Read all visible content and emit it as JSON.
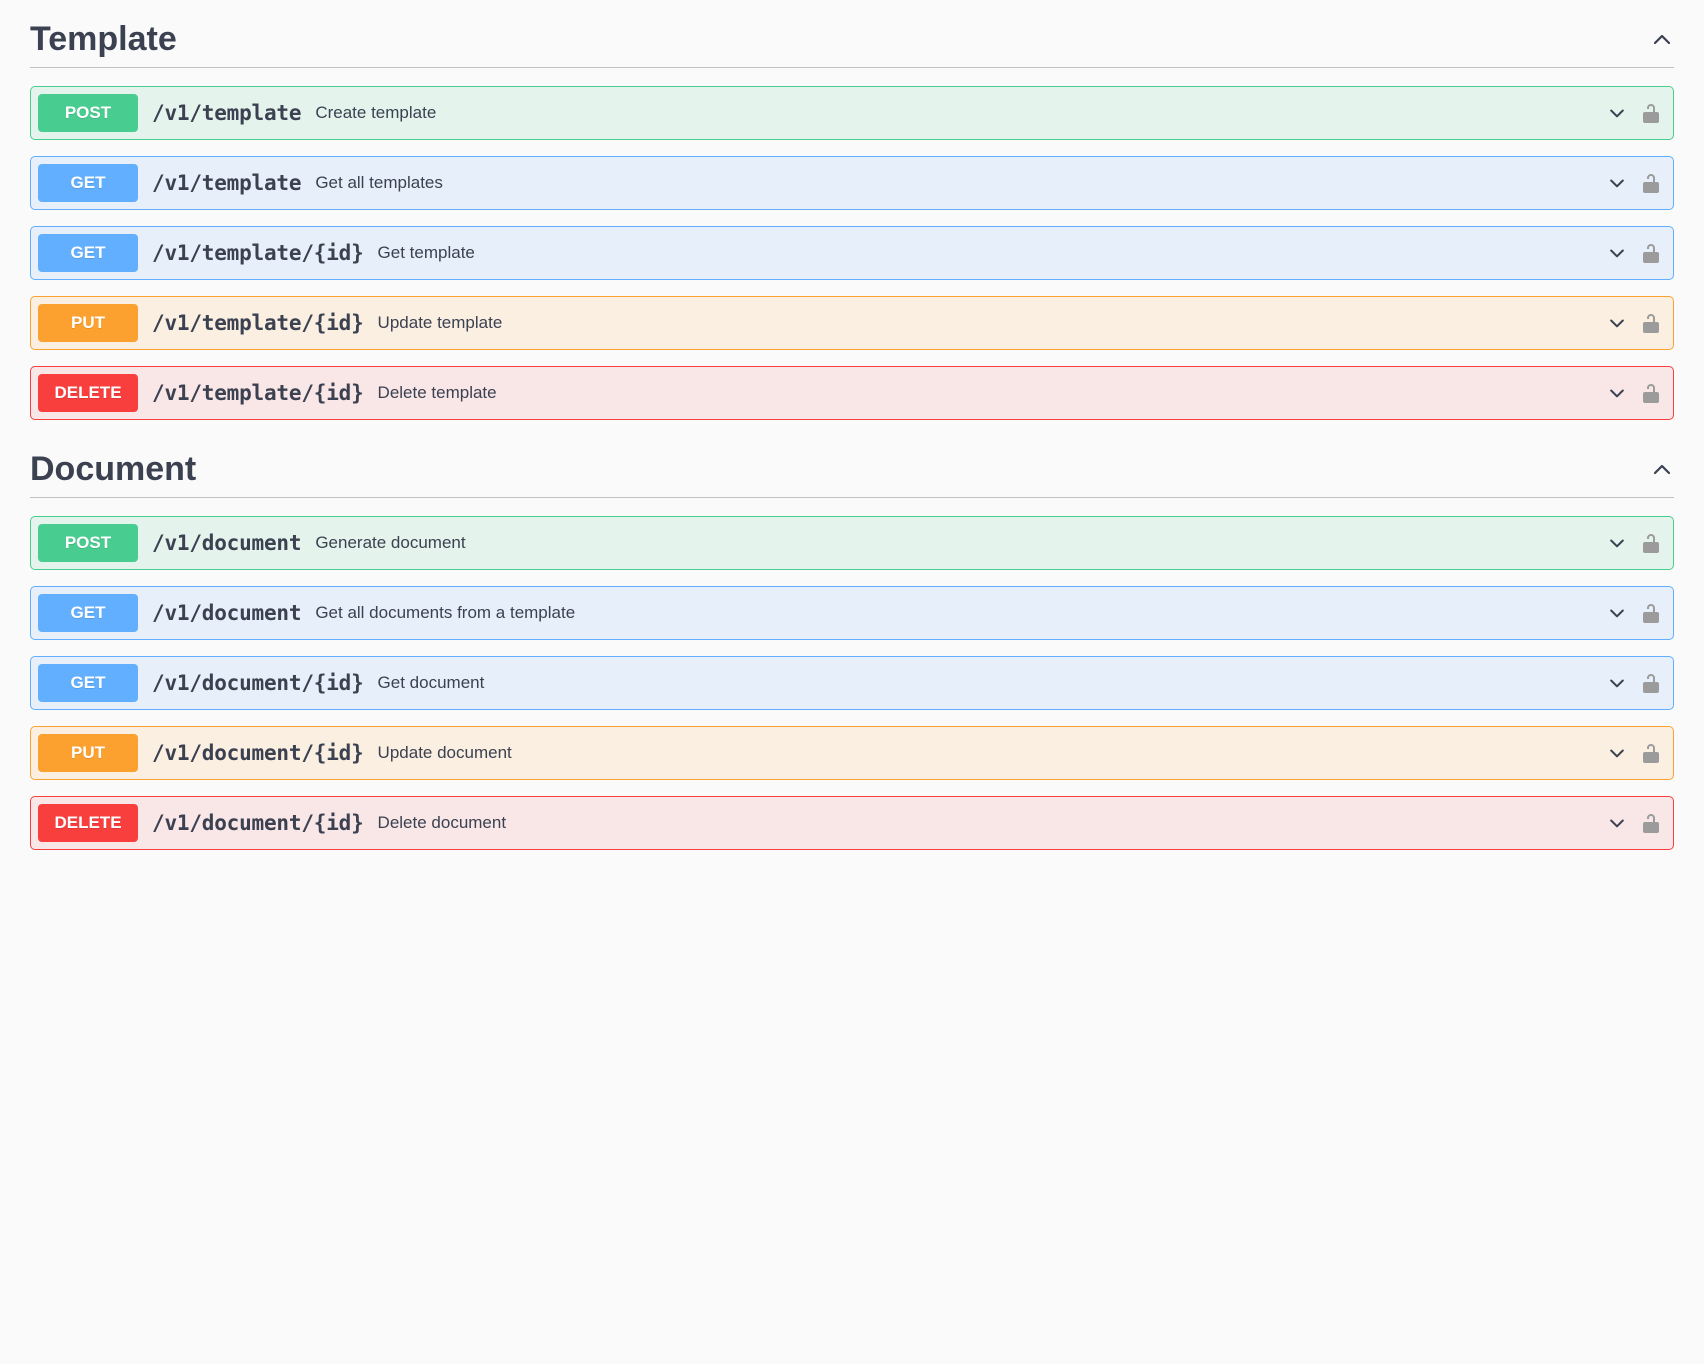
{
  "sections": [
    {
      "title": "Template",
      "endpoints": [
        {
          "method": "POST",
          "path": "/v1/template",
          "summary": "Create template"
        },
        {
          "method": "GET",
          "path": "/v1/template",
          "summary": "Get all templates"
        },
        {
          "method": "GET",
          "path": "/v1/template/{id}",
          "summary": "Get template"
        },
        {
          "method": "PUT",
          "path": "/v1/template/{id}",
          "summary": "Update template"
        },
        {
          "method": "DELETE",
          "path": "/v1/template/{id}",
          "summary": "Delete template"
        }
      ]
    },
    {
      "title": "Document",
      "endpoints": [
        {
          "method": "POST",
          "path": "/v1/document",
          "summary": "Generate document"
        },
        {
          "method": "GET",
          "path": "/v1/document",
          "summary": "Get all documents from a template"
        },
        {
          "method": "GET",
          "path": "/v1/document/{id}",
          "summary": "Get document"
        },
        {
          "method": "PUT",
          "path": "/v1/document/{id}",
          "summary": "Update document"
        },
        {
          "method": "DELETE",
          "path": "/v1/document/{id}",
          "summary": "Delete document"
        }
      ]
    }
  ]
}
